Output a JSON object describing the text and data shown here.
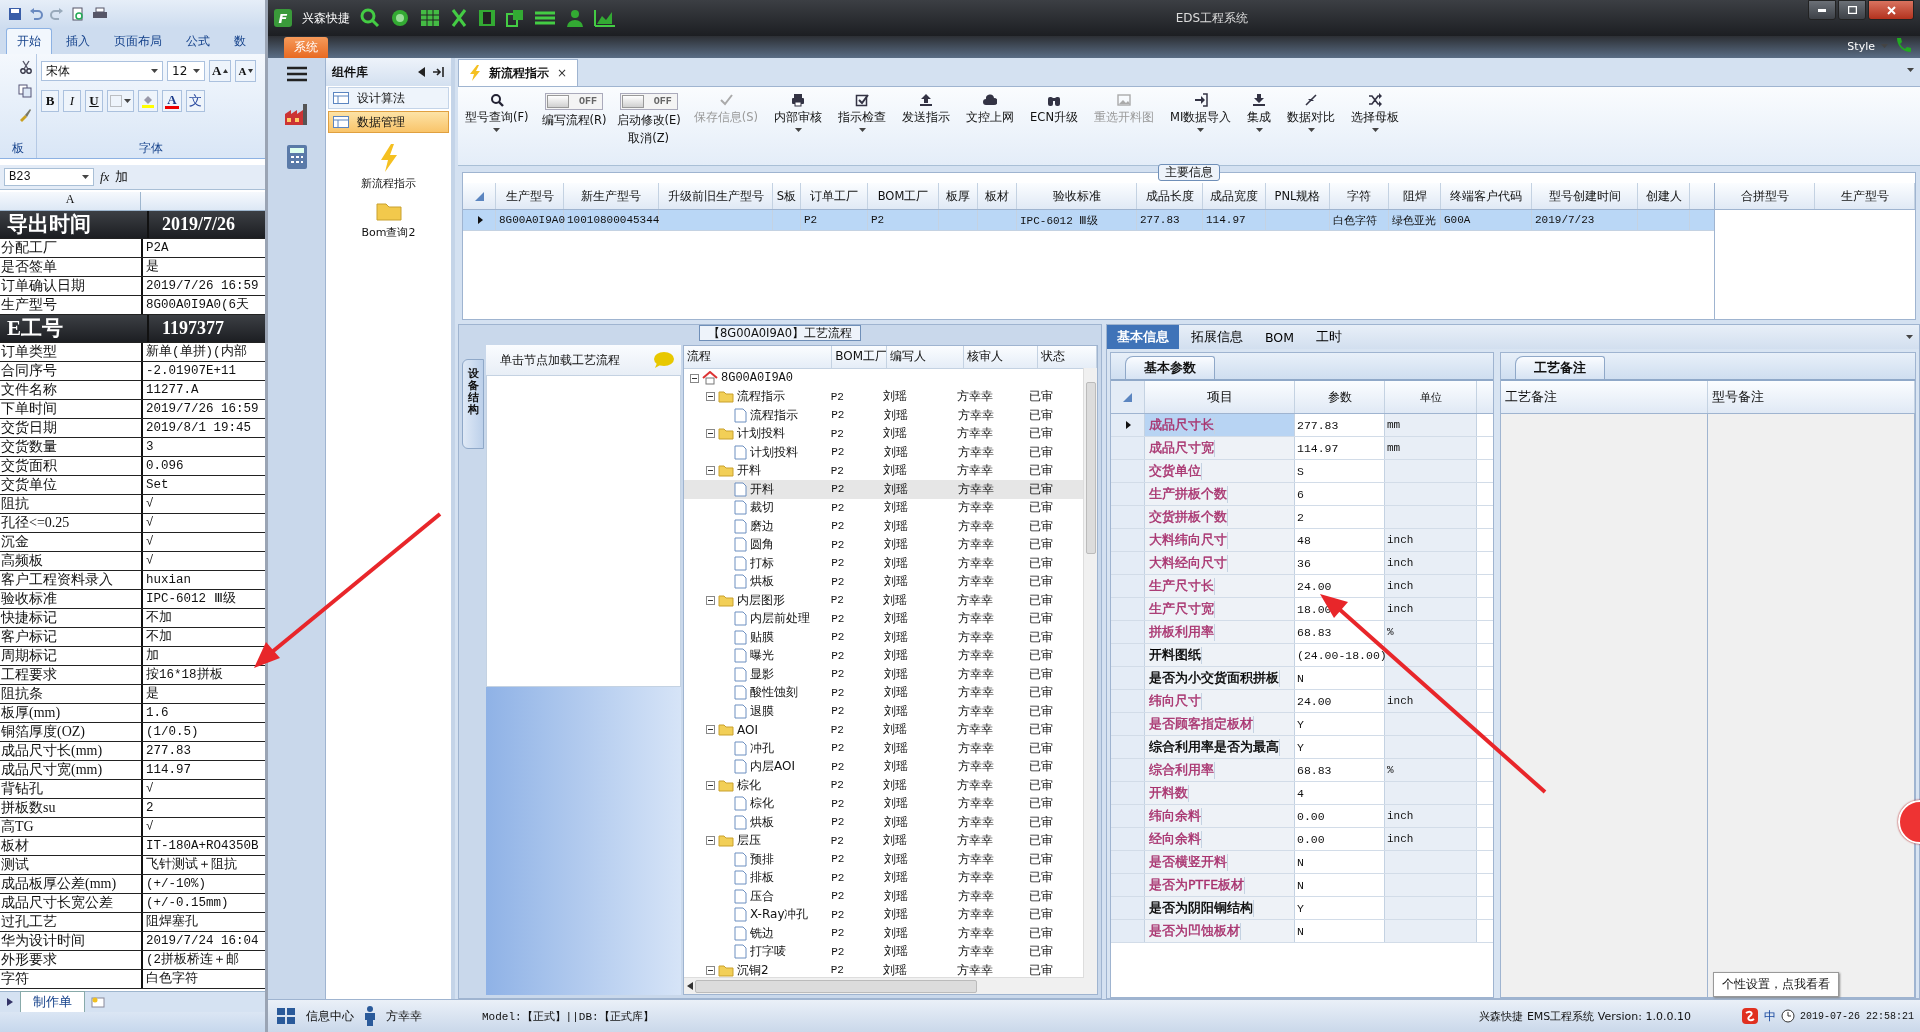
{
  "excel": {
    "tabs": [
      {
        "label": "开始",
        "selected": true
      },
      {
        "label": "插入",
        "selected": false
      },
      {
        "label": "页面布局",
        "selected": false
      },
      {
        "label": "公式",
        "selected": false
      },
      {
        "label": "数",
        "selected": false
      }
    ],
    "font": "宋体",
    "font_size": "12",
    "font_tools": [
      {
        "kind": "grow",
        "label": "A"
      },
      {
        "kind": "shrink",
        "label": "A"
      },
      {
        "kind": "color",
        "label": "A"
      },
      {
        "kind": "phonetic",
        "label": "文"
      }
    ],
    "format_buttons": [
      "B",
      "I",
      "U"
    ],
    "groups": [
      "板",
      "字体"
    ],
    "name_box": "B23",
    "function_label": "fx",
    "formula": "加",
    "column_header": "A",
    "rows": [
      {
        "kind": "title",
        "label": "导出时间",
        "value": "2019/7/26"
      },
      {
        "kind": "normal",
        "label": "分配工厂",
        "value": "P2A"
      },
      {
        "kind": "normal",
        "label": "是否签单",
        "value": "是"
      },
      {
        "kind": "normal",
        "label": "订单确认日期",
        "value": "2019/7/26 16:59"
      },
      {
        "kind": "normal",
        "label": "生产型号",
        "value": "8G00A0I9A0(6天"
      },
      {
        "kind": "title",
        "label": "E工号",
        "value": "1197377"
      },
      {
        "kind": "normal",
        "label": "订单类型",
        "value": "新单(单拼)(内部"
      },
      {
        "kind": "normal",
        "label": "合同序号",
        "value": "-2.01907E+11"
      },
      {
        "kind": "normal",
        "label": "文件名称",
        "value": "11277.A"
      },
      {
        "kind": "normal",
        "label": "下单时间",
        "value": "2019/7/26 16:59"
      },
      {
        "kind": "normal",
        "label": "交货日期",
        "value": "2019/8/1 19:45"
      },
      {
        "kind": "normal",
        "label": "交货数量",
        "value": "3"
      },
      {
        "kind": "normal",
        "label": "交货面积",
        "value": "0.096"
      },
      {
        "kind": "normal",
        "label": "交货单位",
        "value": "Set"
      },
      {
        "kind": "normal",
        "label": "阻抗",
        "value": "√"
      },
      {
        "kind": "normal",
        "label": "孔径<=0.25",
        "value": "√"
      },
      {
        "kind": "normal",
        "label": "沉金",
        "value": "√"
      },
      {
        "kind": "normal",
        "label": "高频板",
        "value": "√"
      },
      {
        "kind": "normal",
        "label": "客户工程资料录入",
        "value": "huxian"
      },
      {
        "kind": "normal",
        "label": "验收标准",
        "value": "IPC-6012 Ⅲ级"
      },
      {
        "kind": "normal",
        "label": "快捷标记",
        "value": "不加"
      },
      {
        "kind": "normal",
        "label": "客户标记",
        "value": "不加"
      },
      {
        "kind": "normal",
        "label": "周期标记",
        "value": "加"
      },
      {
        "kind": "normal",
        "label": "工程要求",
        "value": "按16*18拼板"
      },
      {
        "kind": "normal",
        "label": "阻抗条",
        "value": "是"
      },
      {
        "kind": "normal",
        "label": "板厚(mm)",
        "value": "1.6"
      },
      {
        "kind": "normal",
        "label": "铜箔厚度(OZ)",
        "value": "(1/0.5)"
      },
      {
        "kind": "normal",
        "label": "成品尺寸长(mm)",
        "value": "277.83"
      },
      {
        "kind": "normal",
        "label": "成品尺寸宽(mm)",
        "value": "114.97"
      },
      {
        "kind": "normal",
        "label": "背钻孔",
        "value": "√"
      },
      {
        "kind": "normal",
        "label": "拼板数su",
        "value": "2"
      },
      {
        "kind": "normal",
        "label": "高TG",
        "value": "√"
      },
      {
        "kind": "normal",
        "label": "板材",
        "value": "IT-180A+RO4350B"
      },
      {
        "kind": "normal",
        "label": "测试",
        "value": "飞针测试＋阻抗"
      },
      {
        "kind": "normal",
        "label": "成品板厚公差(mm)",
        "value": "(+/-10%)"
      },
      {
        "kind": "normal",
        "label": "成品尺寸长宽公差",
        "value": "(+/-0.15mm)"
      },
      {
        "kind": "normal",
        "label": "过孔工艺",
        "value": "阻焊塞孔"
      },
      {
        "kind": "normal",
        "label": "华为设计时间",
        "value": "2019/7/24 16:04"
      },
      {
        "kind": "normal",
        "label": "外形要求",
        "value": "(2拼板桥连＋邮"
      },
      {
        "kind": "normal",
        "label": "字符",
        "value": "白色字符"
      }
    ],
    "sheet_tab": "制作单"
  },
  "app": {
    "logo": "F",
    "brand": "兴森快捷",
    "window_title": "EDS工程系统",
    "menu_tab": "系统",
    "style_label": "Style"
  },
  "side_panel": {
    "title": "组件库",
    "items": [
      {
        "label": "设计算法",
        "selected": false
      },
      {
        "label": "数据管理",
        "selected": true
      }
    ],
    "tiles": [
      "新流程指示",
      "Bom查询2"
    ]
  },
  "document_tab": {
    "label": "新流程指示",
    "close": "×"
  },
  "toolbar": [
    {
      "kind": "button",
      "label": "型号查询(F)",
      "dropdown": true,
      "disabled": false
    },
    {
      "kind": "toggle",
      "label": "编写流程(R)",
      "state_text": "OFF",
      "on": false
    },
    {
      "kind": "toggle",
      "label": "启动修改(E)",
      "sublabel": "取消(Z)",
      "state_text": "OFF",
      "on": false
    },
    {
      "kind": "button",
      "label": "保存信息(S)",
      "dropdown": false,
      "disabled": true
    },
    {
      "kind": "button",
      "label": "内部审核",
      "dropdown": true,
      "disabled": false
    },
    {
      "kind": "button",
      "label": "指示检查",
      "dropdown": true,
      "disabled": false
    },
    {
      "kind": "button",
      "label": "发送指示",
      "dropdown": false,
      "disabled": false
    },
    {
      "kind": "button",
      "label": "文控上网",
      "dropdown": false,
      "disabled": false
    },
    {
      "kind": "button",
      "label": "ECN升级",
      "dropdown": false,
      "disabled": false
    },
    {
      "kind": "button",
      "label": "重选开料图",
      "dropdown": false,
      "disabled": true
    },
    {
      "kind": "button",
      "label": "MI数据导入",
      "dropdown": true,
      "disabled": false
    },
    {
      "kind": "button",
      "label": "集成",
      "dropdown": true,
      "disabled": false
    },
    {
      "kind": "button",
      "label": "数据对比",
      "dropdown": true,
      "disabled": false
    },
    {
      "kind": "button",
      "label": "选择母板",
      "dropdown": true,
      "disabled": false
    }
  ],
  "main_info": {
    "title": "主要信息",
    "columns": [
      "生产型号",
      "新生产型号",
      "升级前旧生产型号",
      "S板",
      "订单工厂",
      "BOM工厂",
      "板厚",
      "板材",
      "验收标准",
      "成品长度",
      "成品宽度",
      "PNL规格",
      "字符",
      "阻焊",
      "终端客户代码",
      "型号创建时间",
      "创建人"
    ],
    "rows": [
      {
        "selected": true,
        "cells": [
          "8G00A0I9A0",
          "10010800045344",
          null,
          null,
          "P2",
          "P2",
          null,
          null,
          "IPC-6012 Ⅲ级",
          "277.83",
          "114.97",
          null,
          "白色字符",
          "绿色亚光",
          "G00A",
          "2019/7/23",
          null
        ]
      }
    ],
    "side_columns": [
      "合拼型号",
      "生产型号"
    ]
  },
  "process": {
    "title": "【8G00A0I9A0】工艺流程",
    "side_tab": "设备结构",
    "hint": "单击节点加载工艺流程",
    "columns": [
      "流程",
      "BOM工厂",
      "编写人",
      "核审人",
      "状态"
    ],
    "tree": [
      {
        "name": "8G00A0I9A0",
        "expanded": true,
        "selected": false,
        "children": [
          {
            "name": "流程指示",
            "bom_factory": "P2",
            "writer": "刘瑶",
            "reviewer": "方幸幸",
            "status": "已审",
            "expanded": true,
            "selected": false,
            "children": [
              {
                "name": "流程指示",
                "bom_factory": "P2",
                "writer": "刘瑶",
                "reviewer": "方幸幸",
                "status": "已审",
                "selected": false
              }
            ]
          },
          {
            "name": "计划投料",
            "bom_factory": "P2",
            "writer": "刘瑶",
            "reviewer": "方幸幸",
            "status": "已审",
            "expanded": true,
            "selected": false,
            "children": [
              {
                "name": "计划投料",
                "bom_factory": "P2",
                "writer": "刘瑶",
                "reviewer": "方幸幸",
                "status": "已审",
                "selected": false
              }
            ]
          },
          {
            "name": "开料",
            "bom_factory": "P2",
            "writer": "刘瑶",
            "reviewer": "方幸幸",
            "status": "已审",
            "expanded": true,
            "selected": false,
            "children": [
              {
                "name": "开料",
                "bom_factory": "P2",
                "writer": "刘瑶",
                "reviewer": "方幸幸",
                "status": "已审",
                "selected": true
              },
              {
                "name": "裁切",
                "bom_factory": "P2",
                "writer": "刘瑶",
                "reviewer": "方幸幸",
                "status": "已审",
                "selected": false
              },
              {
                "name": "磨边",
                "bom_factory": "P2",
                "writer": "刘瑶",
                "reviewer": "方幸幸",
                "status": "已审",
                "selected": false
              },
              {
                "name": "圆角",
                "bom_factory": "P2",
                "writer": "刘瑶",
                "reviewer": "方幸幸",
                "status": "已审",
                "selected": false
              },
              {
                "name": "打标",
                "bom_factory": "P2",
                "writer": "刘瑶",
                "reviewer": "方幸幸",
                "status": "已审",
                "selected": false
              },
              {
                "name": "烘板",
                "bom_factory": "P2",
                "writer": "刘瑶",
                "reviewer": "方幸幸",
                "status": "已审",
                "selected": false
              }
            ]
          },
          {
            "name": "内层图形",
            "bom_factory": "P2",
            "writer": "刘瑶",
            "reviewer": "方幸幸",
            "status": "已审",
            "expanded": true,
            "selected": false,
            "children": [
              {
                "name": "内层前处理",
                "bom_factory": "P2",
                "writer": "刘瑶",
                "reviewer": "方幸幸",
                "status": "已审",
                "selected": false
              },
              {
                "name": "贴膜",
                "bom_factory": "P2",
                "writer": "刘瑶",
                "reviewer": "方幸幸",
                "status": "已审",
                "selected": false
              },
              {
                "name": "曝光",
                "bom_factory": "P2",
                "writer": "刘瑶",
                "reviewer": "方幸幸",
                "status": "已审",
                "selected": false
              },
              {
                "name": "显影",
                "bom_factory": "P2",
                "writer": "刘瑶",
                "reviewer": "方幸幸",
                "status": "已审",
                "selected": false
              },
              {
                "name": "酸性蚀刻",
                "bom_factory": "P2",
                "writer": "刘瑶",
                "reviewer": "方幸幸",
                "status": "已审",
                "selected": false
              },
              {
                "name": "退膜",
                "bom_factory": "P2",
                "writer": "刘瑶",
                "reviewer": "方幸幸",
                "status": "已审",
                "selected": false
              }
            ]
          },
          {
            "name": "AOI",
            "bom_factory": "P2",
            "writer": "刘瑶",
            "reviewer": "方幸幸",
            "status": "已审",
            "expanded": true,
            "selected": false,
            "children": [
              {
                "name": "冲孔",
                "bom_factory": "P2",
                "writer": "刘瑶",
                "reviewer": "方幸幸",
                "status": "已审",
                "selected": false
              },
              {
                "name": "内层AOI",
                "bom_factory": "P2",
                "writer": "刘瑶",
                "reviewer": "方幸幸",
                "status": "已审",
                "selected": false
              }
            ]
          },
          {
            "name": "棕化",
            "bom_factory": "P2",
            "writer": "刘瑶",
            "reviewer": "方幸幸",
            "status": "已审",
            "expanded": true,
            "selected": false,
            "children": [
              {
                "name": "棕化",
                "bom_factory": "P2",
                "writer": "刘瑶",
                "reviewer": "方幸幸",
                "status": "已审",
                "selected": false
              },
              {
                "name": "烘板",
                "bom_factory": "P2",
                "writer": "刘瑶",
                "reviewer": "方幸幸",
                "status": "已审",
                "selected": false
              }
            ]
          },
          {
            "name": "层压",
            "bom_factory": "P2",
            "writer": "刘瑶",
            "reviewer": "方幸幸",
            "status": "已审",
            "expanded": true,
            "selected": false,
            "children": [
              {
                "name": "预排",
                "bom_factory": "P2",
                "writer": "刘瑶",
                "reviewer": "方幸幸",
                "status": "已审",
                "selected": false
              },
              {
                "name": "排板",
                "bom_factory": "P2",
                "writer": "刘瑶",
                "reviewer": "方幸幸",
                "status": "已审",
                "selected": false
              },
              {
                "name": "压合",
                "bom_factory": "P2",
                "writer": "刘瑶",
                "reviewer": "方幸幸",
                "status": "已审",
                "selected": false
              },
              {
                "name": "X-Ray冲孔",
                "bom_factory": "P2",
                "writer": "刘瑶",
                "reviewer": "方幸幸",
                "status": "已审",
                "selected": false
              },
              {
                "name": "铣边",
                "bom_factory": "P2",
                "writer": "刘瑶",
                "reviewer": "方幸幸",
                "status": "已审",
                "selected": false
              },
              {
                "name": "打字唛",
                "bom_factory": "P2",
                "writer": "刘瑶",
                "reviewer": "方幸幸",
                "status": "已审",
                "selected": false
              }
            ]
          },
          {
            "name": "沉铜2",
            "bom_factory": "P2",
            "writer": "刘瑶",
            "reviewer": "方幸幸",
            "status": "已审",
            "expanded": true,
            "selected": false
          }
        ]
      }
    ]
  },
  "properties": {
    "tabs": [
      {
        "label": "基本信息",
        "selected": true
      },
      {
        "label": "拓展信息",
        "selected": false
      },
      {
        "label": "BOM",
        "selected": false
      },
      {
        "label": "工时",
        "selected": false
      }
    ],
    "subtab": "基本参数",
    "columns": [
      "项目",
      "参数",
      "单位"
    ],
    "rows": [
      {
        "name": "成品尺寸长",
        "value": "277.83",
        "unit": "mm",
        "color": "#a8326e",
        "selected": true
      },
      {
        "name": "成品尺寸宽",
        "value": "114.97",
        "unit": "mm",
        "color": "#a8326e",
        "selected": false
      },
      {
        "name": "交货单位",
        "value": "S",
        "color": "#a8326e",
        "selected": false
      },
      {
        "name": "生产拼板个数",
        "value": "6",
        "color": "#a8326e",
        "selected": false
      },
      {
        "name": "交货拼板个数",
        "value": "2",
        "color": "#a8326e",
        "selected": false
      },
      {
        "name": "大料纬向尺寸",
        "value": "48",
        "unit": "inch",
        "color": "#a8326e",
        "selected": false
      },
      {
        "name": "大料经向尺寸",
        "value": "36",
        "unit": "inch",
        "color": "#a8326e",
        "selected": false
      },
      {
        "name": "生产尺寸长",
        "value": "24.00",
        "unit": "inch",
        "color": "#a8326e",
        "selected": false
      },
      {
        "name": "生产尺寸宽",
        "value": "18.00",
        "unit": "inch",
        "color": "#a8326e",
        "selected": false
      },
      {
        "name": "拼板利用率",
        "value": "68.83",
        "unit": "%",
        "color": "#a8326e",
        "selected": false
      },
      {
        "name": "开料图纸",
        "value": "(24.00-18.00)",
        "color": "#000000",
        "selected": false
      },
      {
        "name": "是否为小交货面积拼板",
        "value": "N",
        "color": "#000000",
        "selected": false
      },
      {
        "name": "纬向尺寸",
        "value": "24.00",
        "unit": "inch",
        "color": "#a8326e",
        "selected": false
      },
      {
        "name": "是否顾客指定板材",
        "value": "Y",
        "color": "#a8326e",
        "selected": false
      },
      {
        "name": "综合利用率是否为最高",
        "value": "Y",
        "color": "#000000",
        "selected": false
      },
      {
        "name": "综合利用率",
        "value": "68.83",
        "unit": "%",
        "color": "#a8326e",
        "selected": false
      },
      {
        "name": "开料数",
        "value": "4",
        "color": "#a8326e",
        "selected": false
      },
      {
        "name": "纬向余料",
        "value": "0.00",
        "unit": "inch",
        "color": "#a8326e",
        "selected": false
      },
      {
        "name": "经向余料",
        "value": "0.00",
        "unit": "inch",
        "color": "#a8326e",
        "selected": false
      },
      {
        "name": "是否横竖开料",
        "value": "N",
        "color": "#a8326e",
        "selected": false
      },
      {
        "name": "是否为PTFE板材",
        "value": "N",
        "color": "#a8326e",
        "selected": false
      },
      {
        "name": "是否为阴阳铜结构",
        "value": "Y",
        "color": "#000000",
        "selected": false
      },
      {
        "name": "是否为凹蚀板材",
        "value": "N",
        "color": "#a8326e",
        "selected": false
      }
    ],
    "notes": {
      "tab": "工艺备注",
      "columns": [
        "工艺备注",
        "型号备注"
      ]
    }
  },
  "tooltip": "个性设置，点我看看",
  "status_bar": {
    "info": "信息中心",
    "user": "方幸幸",
    "model": "Model:【正式】||DB:【正式库】",
    "version": "兴森快捷 EMS工程系统 Version: 1.0.0.10",
    "ime": "中",
    "clock": "2019-07-26 22:58:21"
  }
}
